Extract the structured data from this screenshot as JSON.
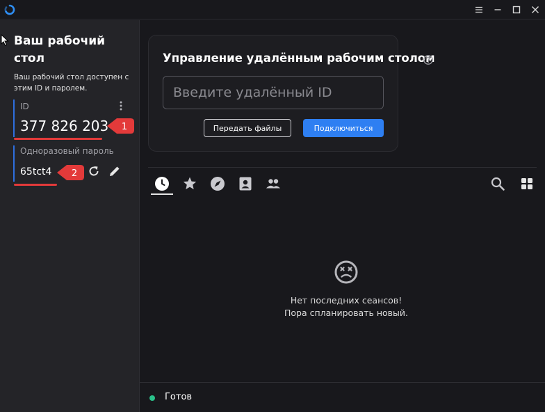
{
  "titlebar": {
    "icons": [
      "app-logo-icon",
      "hamburger-menu-icon",
      "minimize-icon",
      "maximize-icon",
      "close-icon"
    ]
  },
  "sidebar": {
    "title": "Ваш рабочий стол",
    "description": "Ваш рабочий стол доступен с этим ID и паролем.",
    "id_label": "ID",
    "id_value": "377 826 203",
    "password_label": "Одноразовый пароль",
    "password_value": "65tct4",
    "annotations": [
      "1",
      "2"
    ]
  },
  "remote": {
    "title": "Управление удалённым рабочим столом",
    "input_placeholder": "Введите удалённый ID",
    "input_value": "",
    "transfer_button": "Передать файлы",
    "connect_button": "Подключиться"
  },
  "tabs": [
    {
      "name": "recent",
      "icon": "clock-icon",
      "active": true
    },
    {
      "name": "favorites",
      "icon": "star-icon",
      "active": false
    },
    {
      "name": "discovered",
      "icon": "compass-icon",
      "active": false
    },
    {
      "name": "address-book",
      "icon": "contact-icon",
      "active": false
    },
    {
      "name": "group",
      "icon": "people-icon",
      "active": false
    }
  ],
  "empty_state": {
    "line1": "Нет последних сеансов!",
    "line2": "Пора спланировать новый."
  },
  "status": {
    "text": "Готов",
    "color": "#2ac18a"
  },
  "colors": {
    "accent": "#2e7ff2",
    "annotation": "#e33a3a",
    "sidebar_bg": "#242428",
    "main_bg": "#18181c"
  }
}
